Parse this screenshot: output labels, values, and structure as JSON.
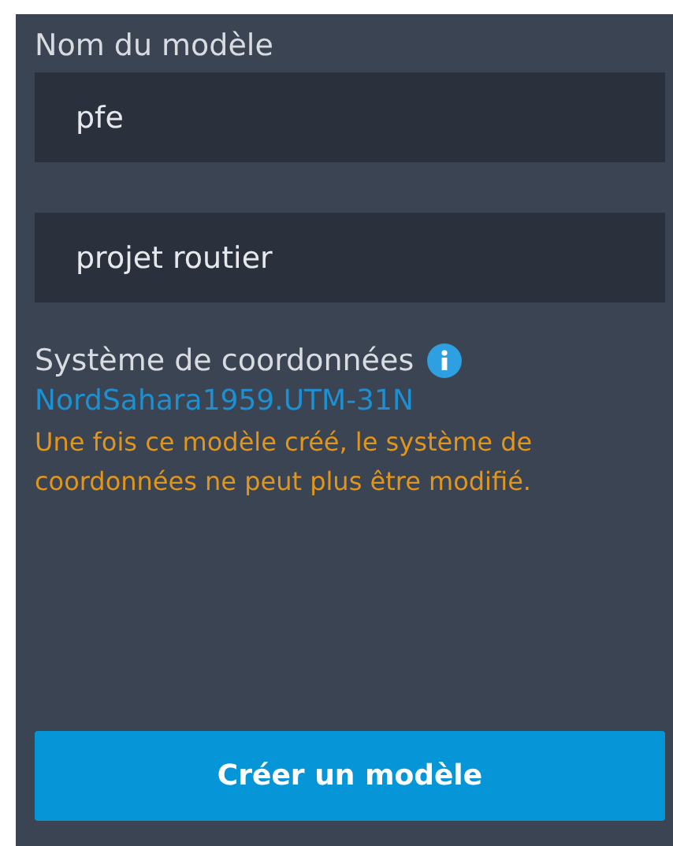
{
  "name_label": "Nom du modèle",
  "fields": [
    {
      "value": "pfe"
    },
    {
      "value": "projet routier"
    }
  ],
  "coordinate_system": {
    "label": "Système de coordonnées",
    "value": "NordSahara1959.UTM-31N",
    "warning": "Une fois ce modèle créé, le système de coordonnées ne peut plus être modifié."
  },
  "button": "Créer un modèle"
}
